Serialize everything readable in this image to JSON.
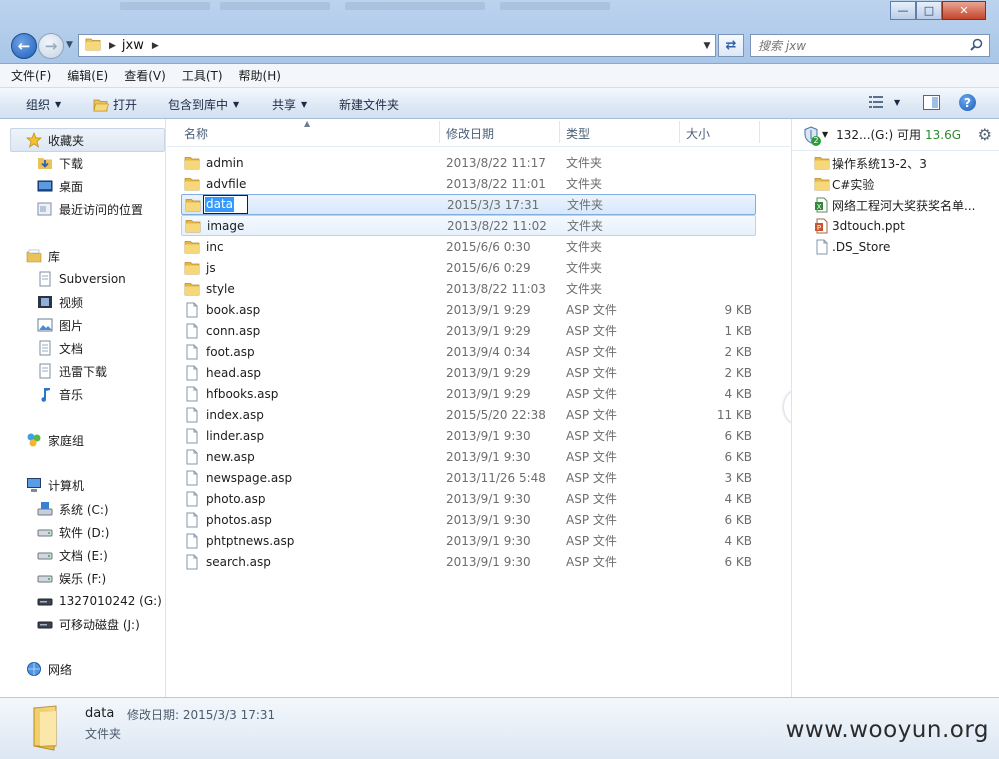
{
  "window": {
    "title_bar_blurred": true,
    "controls": {
      "minimize": "—",
      "maximize": "□",
      "close": "✕"
    }
  },
  "address": {
    "path": "jxw",
    "search_placeholder": "搜索 jxw"
  },
  "menu": [
    "文件(F)",
    "编辑(E)",
    "查看(V)",
    "工具(T)",
    "帮助(H)"
  ],
  "commands": {
    "organize": "组织",
    "open": "打开",
    "include_library": "包含到库中",
    "share": "共享",
    "new_folder": "新建文件夹"
  },
  "nav": {
    "favorites": {
      "label": "收藏夹",
      "items": [
        "下载",
        "桌面",
        "最近访问的位置"
      ]
    },
    "libraries": {
      "label": "库",
      "items": [
        "Subversion",
        "视频",
        "图片",
        "文档",
        "迅雷下载",
        "音乐"
      ]
    },
    "homegroup": "家庭组",
    "computer": {
      "label": "计算机",
      "items": [
        "系统 (C:)",
        "软件 (D:)",
        "文档 (E:)",
        "娱乐 (F:)",
        "1327010242 (G:)",
        "可移动磁盘 (J:)"
      ]
    },
    "network": "网络"
  },
  "columns": {
    "name": "名称",
    "date": "修改日期",
    "type": "类型",
    "size": "大小"
  },
  "files": [
    {
      "name": "admin",
      "date": "2013/8/22 11:17",
      "type": "文件夹",
      "size": "",
      "kind": "folder"
    },
    {
      "name": "advfile",
      "date": "2013/8/22 11:01",
      "type": "文件夹",
      "size": "",
      "kind": "folder"
    },
    {
      "name": "data",
      "date": "2015/3/3 17:31",
      "type": "文件夹",
      "size": "",
      "kind": "folder"
    },
    {
      "name": "image",
      "date": "2013/8/22 11:02",
      "type": "文件夹",
      "size": "",
      "kind": "folder"
    },
    {
      "name": "inc",
      "date": "2015/6/6 0:30",
      "type": "文件夹",
      "size": "",
      "kind": "folder"
    },
    {
      "name": "js",
      "date": "2015/6/6 0:29",
      "type": "文件夹",
      "size": "",
      "kind": "folder"
    },
    {
      "name": "style",
      "date": "2013/8/22 11:03",
      "type": "文件夹",
      "size": "",
      "kind": "folder"
    },
    {
      "name": "book.asp",
      "date": "2013/9/1 9:29",
      "type": "ASP 文件",
      "size": "9 KB",
      "kind": "file"
    },
    {
      "name": "conn.asp",
      "date": "2013/9/1 9:29",
      "type": "ASP 文件",
      "size": "1 KB",
      "kind": "file"
    },
    {
      "name": "foot.asp",
      "date": "2013/9/4 0:34",
      "type": "ASP 文件",
      "size": "2 KB",
      "kind": "file"
    },
    {
      "name": "head.asp",
      "date": "2013/9/1 9:29",
      "type": "ASP 文件",
      "size": "2 KB",
      "kind": "file"
    },
    {
      "name": "hfbooks.asp",
      "date": "2013/9/1 9:29",
      "type": "ASP 文件",
      "size": "4 KB",
      "kind": "file"
    },
    {
      "name": "index.asp",
      "date": "2015/5/20 22:38",
      "type": "ASP 文件",
      "size": "11 KB",
      "kind": "file"
    },
    {
      "name": "linder.asp",
      "date": "2013/9/1 9:30",
      "type": "ASP 文件",
      "size": "6 KB",
      "kind": "file"
    },
    {
      "name": "new.asp",
      "date": "2013/9/1 9:30",
      "type": "ASP 文件",
      "size": "6 KB",
      "kind": "file"
    },
    {
      "name": "newspage.asp",
      "date": "2013/11/26 5:48",
      "type": "ASP 文件",
      "size": "3 KB",
      "kind": "file"
    },
    {
      "name": "photo.asp",
      "date": "2013/9/1 9:30",
      "type": "ASP 文件",
      "size": "4 KB",
      "kind": "file"
    },
    {
      "name": "photos.asp",
      "date": "2013/9/1 9:30",
      "type": "ASP 文件",
      "size": "6 KB",
      "kind": "file"
    },
    {
      "name": "phtptnews.asp",
      "date": "2013/9/1 9:30",
      "type": "ASP 文件",
      "size": "4 KB",
      "kind": "file"
    },
    {
      "name": "search.asp",
      "date": "2013/9/1 9:30",
      "type": "ASP 文件",
      "size": "6 KB",
      "kind": "file"
    }
  ],
  "selected_index": 2,
  "hovered_index": 3,
  "right_pane": {
    "drive_label": "132...(G:) 可用",
    "free_space": "13.6G",
    "badge": "2",
    "items": [
      {
        "name": "操作系统13-2、3",
        "icon": "folder-icon"
      },
      {
        "name": "C#实验",
        "icon": "folder-icon"
      },
      {
        "name": "网络工程河大奖获奖名单...",
        "icon": "excel-icon"
      },
      {
        "name": "3dtouch.ppt",
        "icon": "powerpoint-icon"
      },
      {
        "name": ".DS_Store",
        "icon": "file-icon"
      }
    ]
  },
  "details": {
    "name": "data",
    "modified_label": "修改日期: 2015/3/3 17:31",
    "type": "文件夹"
  },
  "watermark": "www.wooyun.org"
}
